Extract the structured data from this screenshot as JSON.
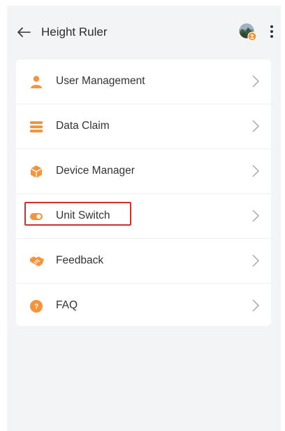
{
  "header": {
    "title": "Height Ruler",
    "back_icon": "arrow-left-icon",
    "more_icon": "more-vertical-icon",
    "avatar_icon": "user-avatar"
  },
  "menu": {
    "items": [
      {
        "label": "User Management",
        "icon": "user-icon"
      },
      {
        "label": "Data Claim",
        "icon": "list-icon"
      },
      {
        "label": "Device Manager",
        "icon": "device-box-icon"
      },
      {
        "label": "Unit Switch",
        "icon": "toggle-icon"
      },
      {
        "label": "Feedback",
        "icon": "handshake-icon"
      },
      {
        "label": "FAQ",
        "icon": "question-icon"
      }
    ],
    "chevron_icon": "chevron-right-icon"
  },
  "colors": {
    "accent": "#f5943a",
    "highlight": "#d32f2f",
    "background": "#f3f4f6",
    "card": "#ffffff",
    "text": "#333333"
  }
}
